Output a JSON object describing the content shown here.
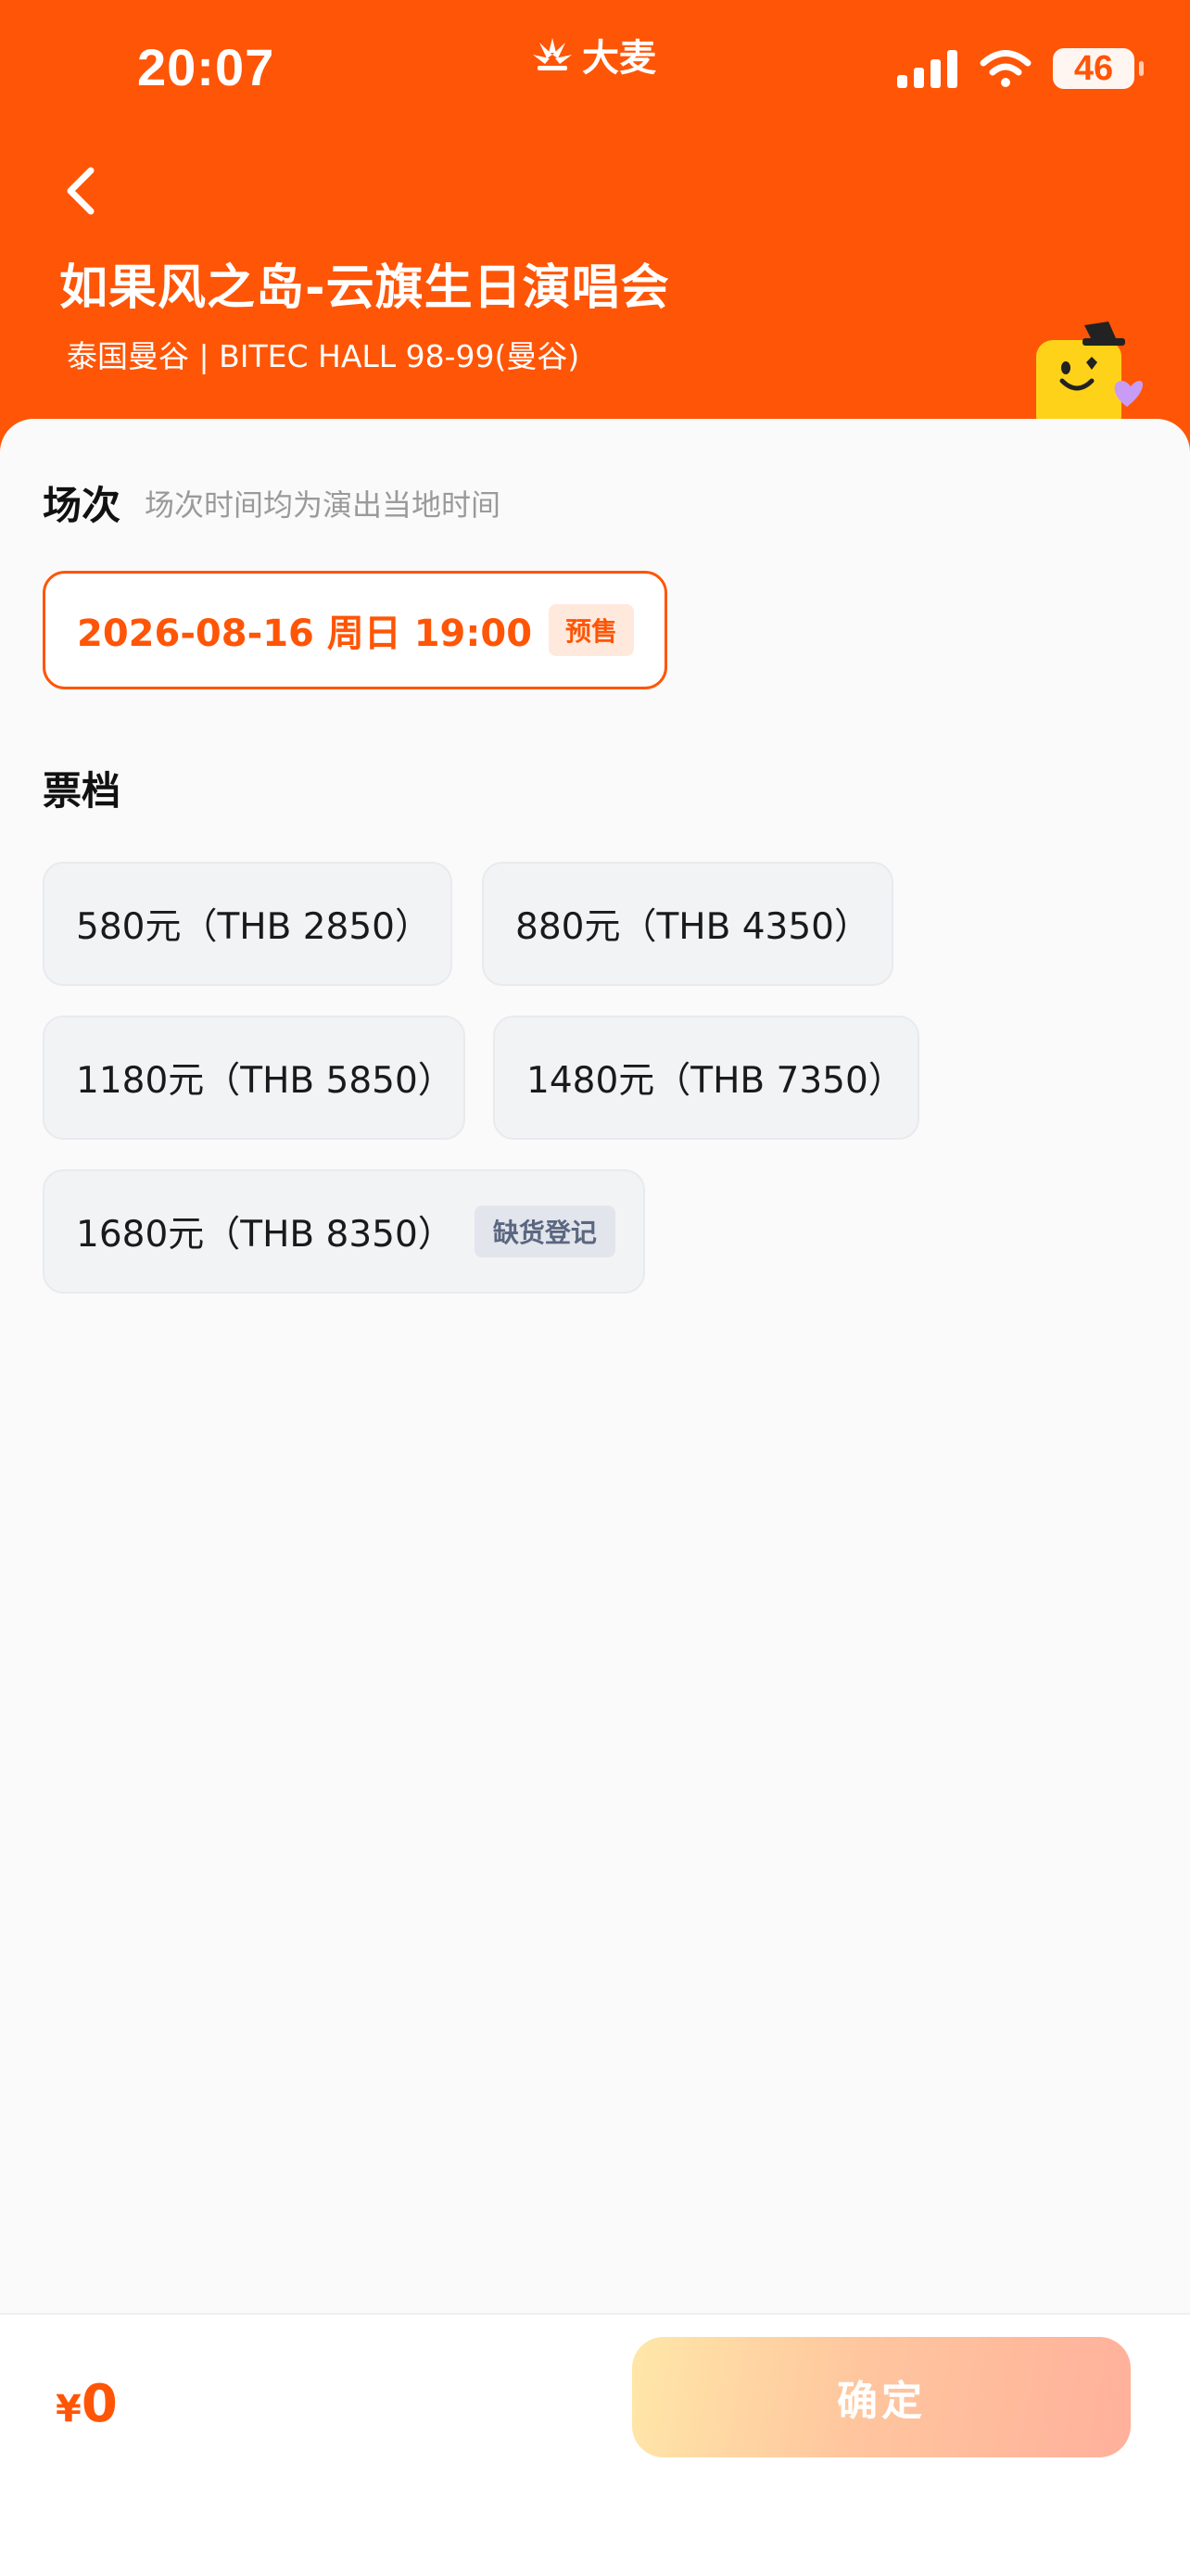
{
  "status_bar": {
    "time": "20:07",
    "brand": "大麦",
    "battery": "46"
  },
  "header": {
    "title": "如果风之岛-云旗生日演唱会",
    "venue": "泰国曼谷 | BITEC HALL 98-99(曼谷)"
  },
  "session": {
    "title": "场次",
    "note": "场次时间均为演出当地时间",
    "option": {
      "label": "2026-08-16  周日 19:00",
      "badge": "预售",
      "selected": true
    }
  },
  "tiers": {
    "title": "票档",
    "items": [
      {
        "label": "580元（THB 2850）"
      },
      {
        "label": "880元（THB 4350）"
      },
      {
        "label": "1180元（THB 5850）"
      },
      {
        "label": "1480元（THB 7350）"
      },
      {
        "label": "1680元（THB 8350）",
        "badge": "缺货登记"
      }
    ]
  },
  "footer": {
    "currency": "¥",
    "total": "0",
    "confirm_label": "确定"
  },
  "colors": {
    "accent": "#ff5506",
    "sheet_bg": "#fafafa",
    "tier_bg": "#f2f3f5"
  },
  "icons": [
    "back-arrow-icon",
    "damai-logo-icon",
    "signal-icon",
    "wifi-icon",
    "battery-icon",
    "mascot-icon"
  ]
}
